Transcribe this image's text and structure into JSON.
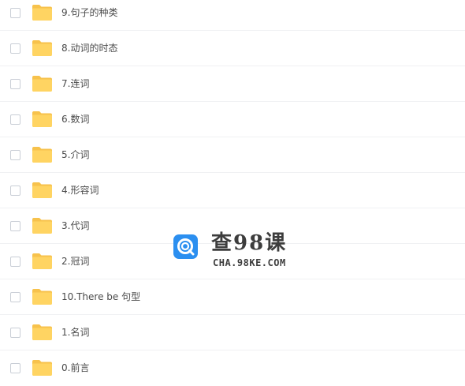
{
  "folders": [
    {
      "name": "9.句子的种类"
    },
    {
      "name": "8.动词的时态"
    },
    {
      "name": "7.连词"
    },
    {
      "name": "6.数词"
    },
    {
      "name": "5.介词"
    },
    {
      "name": "4.形容词"
    },
    {
      "name": "3.代词"
    },
    {
      "name": "2.冠词"
    },
    {
      "name": "10.There be 句型"
    },
    {
      "name": "1.名词"
    },
    {
      "name": "0.前言"
    }
  ],
  "watermark": {
    "title": "查98课",
    "domain": "CHA.98KE.COM"
  },
  "icons": {
    "row": "folder-icon",
    "watermark": "search-logo-icon"
  },
  "colors": {
    "folder": "#ffd462",
    "folder_back": "#f7c24c",
    "logo": "#2b8ff0",
    "text": "#4a4a4a"
  }
}
